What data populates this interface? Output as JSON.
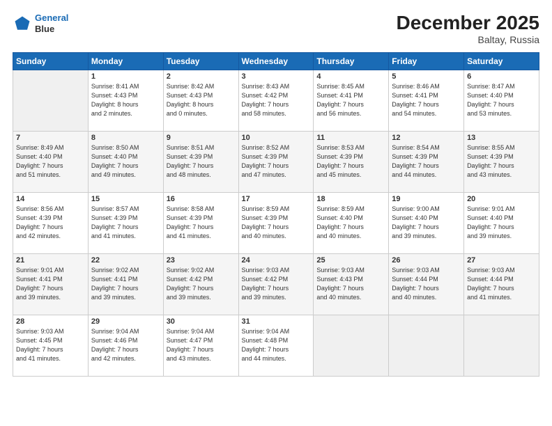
{
  "header": {
    "logo_line1": "General",
    "logo_line2": "Blue",
    "title": "December 2025",
    "subtitle": "Baltay, Russia"
  },
  "days_of_week": [
    "Sunday",
    "Monday",
    "Tuesday",
    "Wednesday",
    "Thursday",
    "Friday",
    "Saturday"
  ],
  "weeks": [
    [
      {
        "day": "",
        "info": ""
      },
      {
        "day": "1",
        "info": "Sunrise: 8:41 AM\nSunset: 4:43 PM\nDaylight: 8 hours\nand 2 minutes."
      },
      {
        "day": "2",
        "info": "Sunrise: 8:42 AM\nSunset: 4:43 PM\nDaylight: 8 hours\nand 0 minutes."
      },
      {
        "day": "3",
        "info": "Sunrise: 8:43 AM\nSunset: 4:42 PM\nDaylight: 7 hours\nand 58 minutes."
      },
      {
        "day": "4",
        "info": "Sunrise: 8:45 AM\nSunset: 4:41 PM\nDaylight: 7 hours\nand 56 minutes."
      },
      {
        "day": "5",
        "info": "Sunrise: 8:46 AM\nSunset: 4:41 PM\nDaylight: 7 hours\nand 54 minutes."
      },
      {
        "day": "6",
        "info": "Sunrise: 8:47 AM\nSunset: 4:40 PM\nDaylight: 7 hours\nand 53 minutes."
      }
    ],
    [
      {
        "day": "7",
        "info": "Sunrise: 8:49 AM\nSunset: 4:40 PM\nDaylight: 7 hours\nand 51 minutes."
      },
      {
        "day": "8",
        "info": "Sunrise: 8:50 AM\nSunset: 4:40 PM\nDaylight: 7 hours\nand 49 minutes."
      },
      {
        "day": "9",
        "info": "Sunrise: 8:51 AM\nSunset: 4:39 PM\nDaylight: 7 hours\nand 48 minutes."
      },
      {
        "day": "10",
        "info": "Sunrise: 8:52 AM\nSunset: 4:39 PM\nDaylight: 7 hours\nand 47 minutes."
      },
      {
        "day": "11",
        "info": "Sunrise: 8:53 AM\nSunset: 4:39 PM\nDaylight: 7 hours\nand 45 minutes."
      },
      {
        "day": "12",
        "info": "Sunrise: 8:54 AM\nSunset: 4:39 PM\nDaylight: 7 hours\nand 44 minutes."
      },
      {
        "day": "13",
        "info": "Sunrise: 8:55 AM\nSunset: 4:39 PM\nDaylight: 7 hours\nand 43 minutes."
      }
    ],
    [
      {
        "day": "14",
        "info": "Sunrise: 8:56 AM\nSunset: 4:39 PM\nDaylight: 7 hours\nand 42 minutes."
      },
      {
        "day": "15",
        "info": "Sunrise: 8:57 AM\nSunset: 4:39 PM\nDaylight: 7 hours\nand 41 minutes."
      },
      {
        "day": "16",
        "info": "Sunrise: 8:58 AM\nSunset: 4:39 PM\nDaylight: 7 hours\nand 41 minutes."
      },
      {
        "day": "17",
        "info": "Sunrise: 8:59 AM\nSunset: 4:39 PM\nDaylight: 7 hours\nand 40 minutes."
      },
      {
        "day": "18",
        "info": "Sunrise: 8:59 AM\nSunset: 4:40 PM\nDaylight: 7 hours\nand 40 minutes."
      },
      {
        "day": "19",
        "info": "Sunrise: 9:00 AM\nSunset: 4:40 PM\nDaylight: 7 hours\nand 39 minutes."
      },
      {
        "day": "20",
        "info": "Sunrise: 9:01 AM\nSunset: 4:40 PM\nDaylight: 7 hours\nand 39 minutes."
      }
    ],
    [
      {
        "day": "21",
        "info": "Sunrise: 9:01 AM\nSunset: 4:41 PM\nDaylight: 7 hours\nand 39 minutes."
      },
      {
        "day": "22",
        "info": "Sunrise: 9:02 AM\nSunset: 4:41 PM\nDaylight: 7 hours\nand 39 minutes."
      },
      {
        "day": "23",
        "info": "Sunrise: 9:02 AM\nSunset: 4:42 PM\nDaylight: 7 hours\nand 39 minutes."
      },
      {
        "day": "24",
        "info": "Sunrise: 9:03 AM\nSunset: 4:42 PM\nDaylight: 7 hours\nand 39 minutes."
      },
      {
        "day": "25",
        "info": "Sunrise: 9:03 AM\nSunset: 4:43 PM\nDaylight: 7 hours\nand 40 minutes."
      },
      {
        "day": "26",
        "info": "Sunrise: 9:03 AM\nSunset: 4:44 PM\nDaylight: 7 hours\nand 40 minutes."
      },
      {
        "day": "27",
        "info": "Sunrise: 9:03 AM\nSunset: 4:44 PM\nDaylight: 7 hours\nand 41 minutes."
      }
    ],
    [
      {
        "day": "28",
        "info": "Sunrise: 9:03 AM\nSunset: 4:45 PM\nDaylight: 7 hours\nand 41 minutes."
      },
      {
        "day": "29",
        "info": "Sunrise: 9:04 AM\nSunset: 4:46 PM\nDaylight: 7 hours\nand 42 minutes."
      },
      {
        "day": "30",
        "info": "Sunrise: 9:04 AM\nSunset: 4:47 PM\nDaylight: 7 hours\nand 43 minutes."
      },
      {
        "day": "31",
        "info": "Sunrise: 9:04 AM\nSunset: 4:48 PM\nDaylight: 7 hours\nand 44 minutes."
      },
      {
        "day": "",
        "info": ""
      },
      {
        "day": "",
        "info": ""
      },
      {
        "day": "",
        "info": ""
      }
    ]
  ]
}
